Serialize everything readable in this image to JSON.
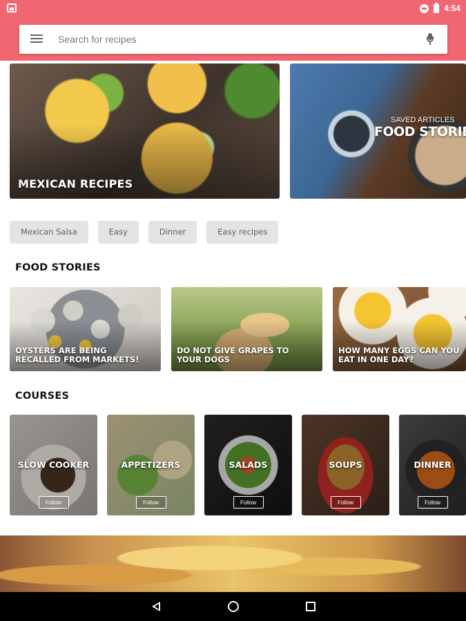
{
  "status_bar": {
    "time": "4:54"
  },
  "search": {
    "placeholder": "Search for recipes"
  },
  "hero_cards": [
    {
      "title": "MEXICAN RECIPES"
    },
    {
      "overline": "SAVED ARTICLES",
      "title": "FOOD STORIES"
    }
  ],
  "chips": [
    "Mexican Salsa",
    "Easy",
    "Dinner",
    "Easy recipes"
  ],
  "food_stories": {
    "title": "FOOD STORIES",
    "items": [
      {
        "title": "OYSTERS ARE BEING\nRECALLED FROM MARKETS!"
      },
      {
        "title": "DO NOT GIVE GRAPES TO\nYOUR DOGS"
      },
      {
        "title": "HOW MANY EGGS CAN YOU\nEAT IN ONE DAY?"
      }
    ]
  },
  "courses": {
    "title": "COURSES",
    "follow_label": "Follow",
    "items": [
      {
        "title": "SLOW COOKER"
      },
      {
        "title": "APPETIZERS"
      },
      {
        "title": "SALADS"
      },
      {
        "title": "SOUPS"
      },
      {
        "title": "DINNER"
      }
    ]
  },
  "colors": {
    "accent": "#f06771",
    "chip_bg": "#e4e4e4",
    "nav_bg": "#000000"
  },
  "icons": [
    "image-icon",
    "do-not-disturb-icon",
    "battery-icon",
    "menu-icon",
    "mic-icon",
    "back-icon",
    "home-icon",
    "recents-icon"
  ]
}
